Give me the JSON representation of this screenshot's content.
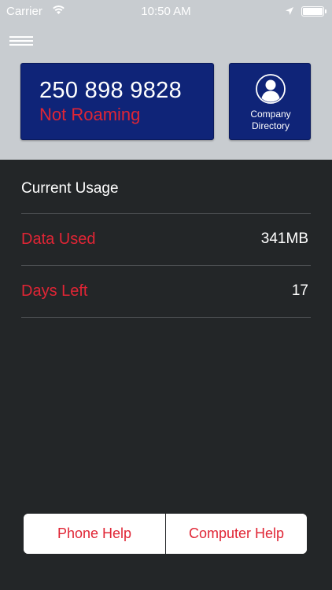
{
  "status_bar": {
    "carrier": "Carrier",
    "time": "10:50 AM"
  },
  "header": {
    "phone_number": "250 898 9828",
    "roaming_status": "Not Roaming",
    "directory_label_line1": "Company",
    "directory_label_line2": "Directory"
  },
  "usage": {
    "title": "Current Usage",
    "rows": [
      {
        "label": "Data Used",
        "value": "341MB"
      },
      {
        "label": "Days Left",
        "value": "17"
      }
    ]
  },
  "footer": {
    "phone_help_label": "Phone Help",
    "computer_help_label": "Computer Help"
  },
  "colors": {
    "header_bg": "#c8ccd0",
    "body_bg": "#232628",
    "card_bg": "#0f2478",
    "accent_red": "#e02535",
    "text_white": "#ffffff"
  },
  "icons": {
    "menu": "hamburger-menu-icon",
    "wifi": "wifi-icon",
    "location": "location-arrow-icon",
    "battery": "battery-icon",
    "directory": "person-avatar-icon"
  }
}
